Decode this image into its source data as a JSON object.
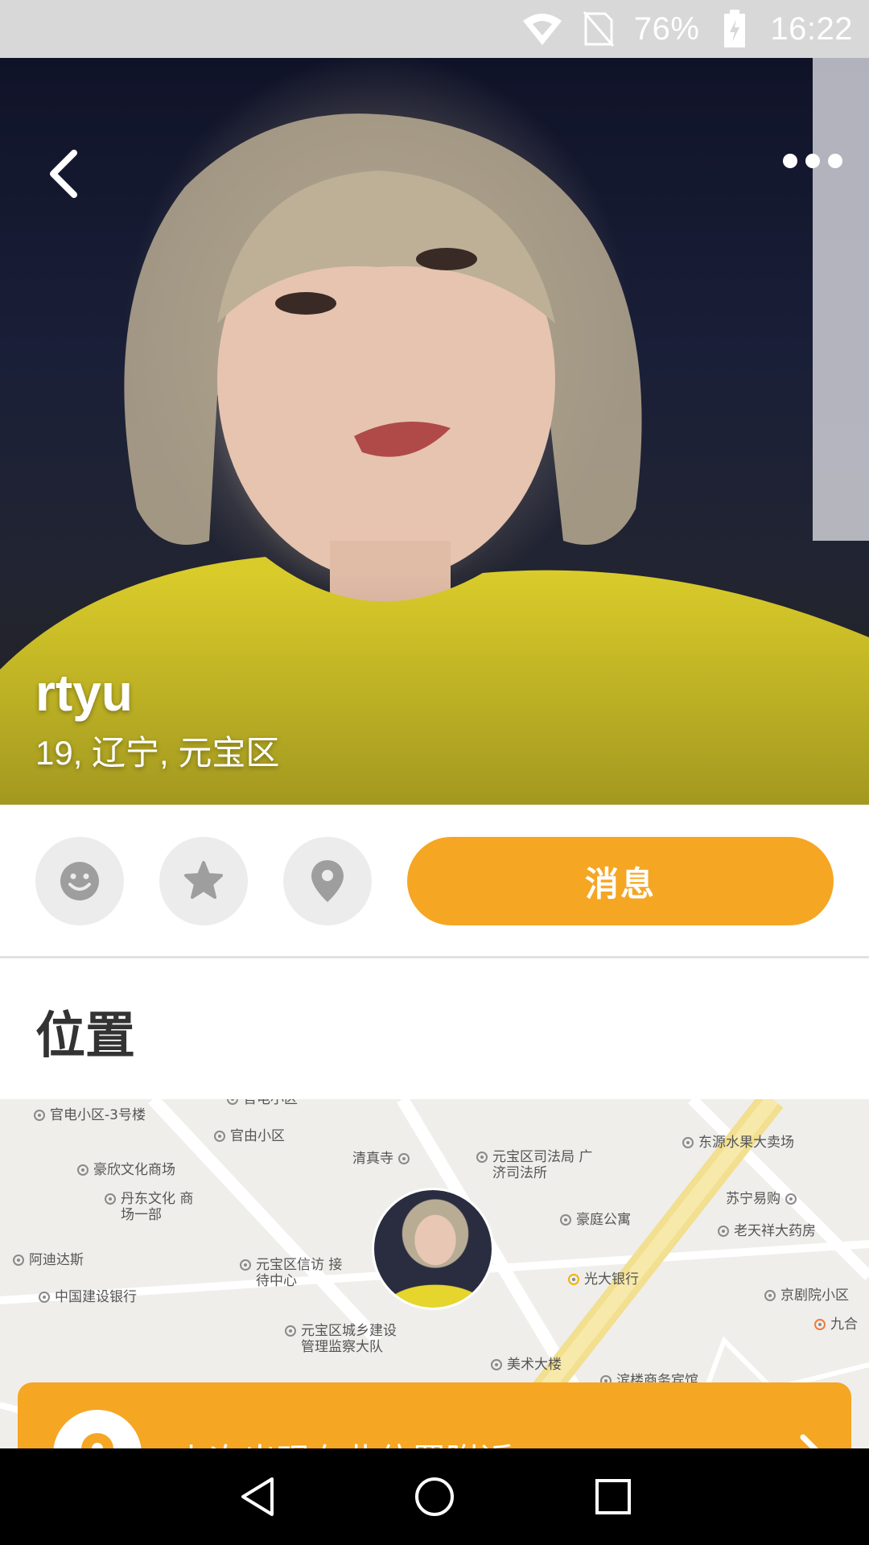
{
  "status_bar": {
    "battery": "76%",
    "time": "16:22",
    "icons": [
      "wifi-icon",
      "no-sim-icon",
      "battery-charging-icon"
    ]
  },
  "header": {
    "back_icon": "chevron-left-icon",
    "more_icon": "more-horizontal-icon"
  },
  "profile": {
    "name": "rtyu",
    "meta": "19, 辽宁, 元宝区"
  },
  "actions": {
    "icons": [
      "smile-icon",
      "star-icon",
      "location-pin-icon"
    ],
    "message_label": "消息",
    "accent_color": "#f5a623"
  },
  "location": {
    "title": "位置",
    "map_labels": [
      "官电小区-3号楼",
      "官电小区",
      "官由小区",
      "清真寺",
      "元宝区司法局 广济司法所",
      "东源水果大卖场",
      "豪欣文化商场",
      "丹东文化 商场一部",
      "苏宁易购",
      "豪庭公寓",
      "老天祥大药房",
      "阿迪达斯",
      "元宝区信访 接待中心",
      "光大银行",
      "中国建设银行",
      "京剧院小区",
      "九合",
      "元宝区城乡建设 管理监察大队",
      "美术大楼",
      "滨楼商务宾馆"
    ],
    "banner_text": "上次出现在此位置附近"
  },
  "nav_bar": {
    "icons": [
      "nav-back-icon",
      "nav-home-icon",
      "nav-recents-icon"
    ]
  }
}
